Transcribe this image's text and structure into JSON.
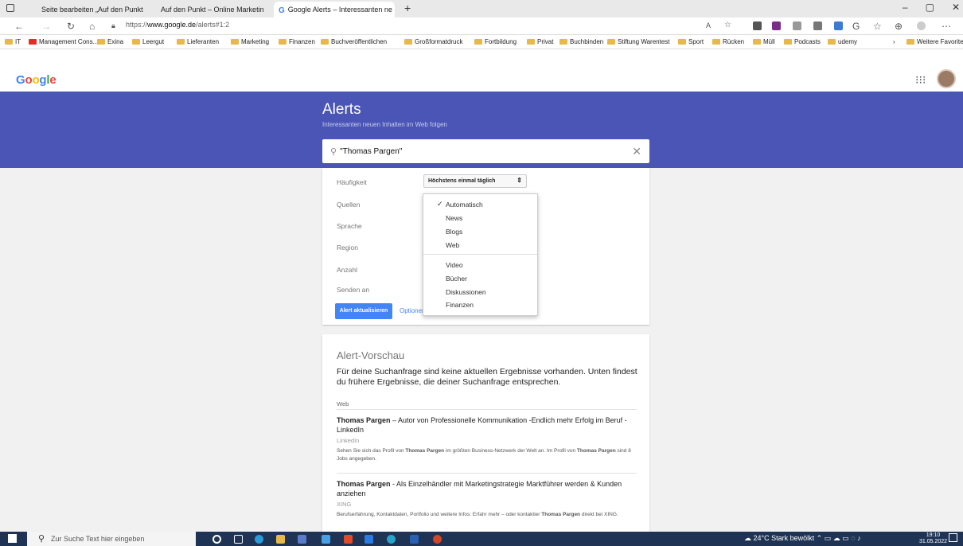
{
  "browser": {
    "tabs": [
      {
        "label": "Seite bearbeiten „Auf den Punkt"
      },
      {
        "label": "Auf den Punkt – Online Marketin"
      },
      {
        "label": "Google Alerts – Interessanten ne"
      }
    ],
    "new_tab": "+",
    "url_prefix": "https://",
    "url_domain": "www.google.de",
    "url_path": "/alerts#1:2",
    "bookmarks": [
      "IT",
      "Management Cons...",
      "Exina",
      "Leergut",
      "Lieferanten",
      "Marketing",
      "Finanzen",
      "Buchveröffentlichen",
      "Großformatdruck",
      "Fortbildung",
      "Privat",
      "Buchbinden",
      "Stiftung Warentest",
      "Sport",
      "Rücken",
      "Müll",
      "Podcasts",
      "udemy"
    ],
    "more_favorites": "Weitere Favoriten"
  },
  "google": {
    "logo": "Google"
  },
  "alerts": {
    "title": "Alerts",
    "subtitle": "Interessanten neuen Inhalten im Web folgen",
    "query": "\"Thomas Pargen\""
  },
  "options": {
    "labels": {
      "frequency": "Häufigkeit",
      "sources": "Quellen",
      "language": "Sprache",
      "region": "Region",
      "count": "Anzahl",
      "send_to": "Senden an"
    },
    "frequency_value": "Höchstens einmal täglich",
    "update_button": "Alert aktualisieren",
    "options_link": "Optionen"
  },
  "dropdown": {
    "selected": "Automatisch",
    "group1": [
      "News",
      "Blogs",
      "Web"
    ],
    "group2": [
      "Video",
      "Bücher",
      "Diskussionen",
      "Finanzen"
    ]
  },
  "preview": {
    "title": "Alert-Vorschau",
    "message": "Für deine Suchanfrage sind keine aktuellen Ergebnisse vorhanden. Unten findest du frühere Ergebnisse, die deiner Suchanfrage entsprechen.",
    "section": "Web",
    "results": [
      {
        "name": "Thomas Pargen",
        "rest": " – Autor von Professionelle Kommunikation -Endlich mehr Erfolg im Beruf - LinkedIn",
        "source": "LinkedIn",
        "snip_a": "Sehen Sie sich das Profil von ",
        "snip_b": "Thomas Pargen",
        "snip_c": " im größten Business-Netzwerk der Welt an. Im Profil von ",
        "snip_d": "Thomas Pargen",
        "snip_e": " sind 8 Jobs angegeben."
      },
      {
        "name": "Thomas Pargen",
        "rest": " - Als Einzelhändler mit Marketingstrategie Marktführer werden & Kunden anziehen",
        "source": "XING",
        "snip_a": "Berufserfahrung, Kontaktdaten, Portfolio und weitere Infos: Erfahr mehr – oder kontaktier ",
        "snip_b": "Thomas Pargen",
        "snip_c": " direkt bei XING."
      }
    ]
  },
  "taskbar": {
    "search_placeholder": "Zur Suche Text hier eingeben",
    "weather": "24°C  Stark bewölkt",
    "time": "19:10",
    "date": "31.05.2022"
  },
  "colors": {
    "banner": "#4a55b5",
    "button": "#4285f4",
    "taskbar": "#1f3354"
  }
}
